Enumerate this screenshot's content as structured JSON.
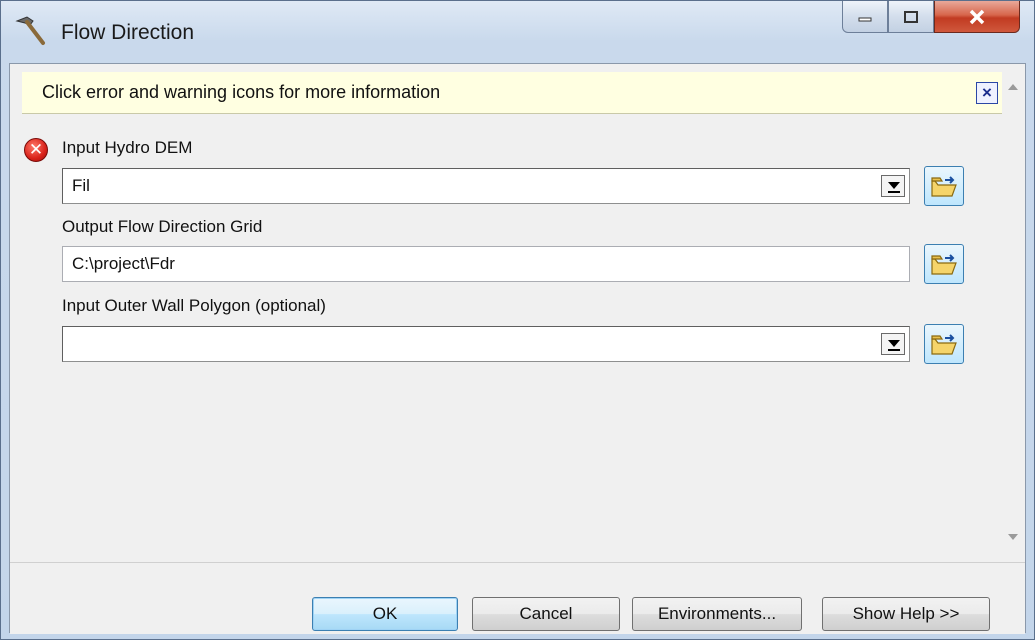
{
  "window": {
    "title": "Flow Direction",
    "icon": "hammer-icon"
  },
  "message_bar": {
    "text": "Click error and warning icons for more information",
    "close_icon": "close-x-icon",
    "close_glyph": "×"
  },
  "fields": [
    {
      "label": "Input Hydro DEM",
      "value": "Fil",
      "type": "combo",
      "status": "error",
      "status_icon": "error-icon",
      "status_glyph": "✕"
    },
    {
      "label": "Output Flow Direction Grid",
      "value": "C:\\project\\Fdr",
      "type": "text"
    },
    {
      "label": "Input Outer Wall Polygon (optional)",
      "value": "",
      "type": "combo"
    }
  ],
  "buttons": {
    "ok": "OK",
    "cancel": "Cancel",
    "environments": "Environments...",
    "help": "Show Help >>"
  },
  "colors": {
    "error": "#d9221a",
    "message_bg": "#ffffe1",
    "default_button": "#3c7fb1"
  }
}
